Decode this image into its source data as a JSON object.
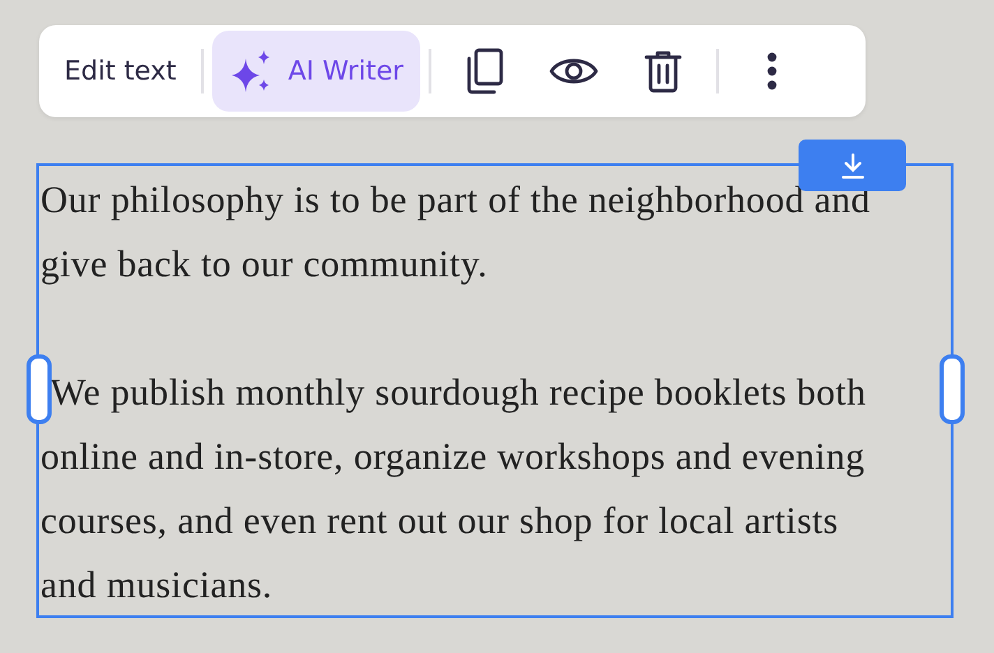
{
  "toolbar": [
    {
      "kind": "text",
      "label": "Edit text",
      "selected": false
    },
    {
      "kind": "divider"
    },
    {
      "kind": "ai",
      "label": "AI Writer",
      "selected": true
    },
    {
      "kind": "divider"
    },
    {
      "kind": "copy",
      "selected": false
    },
    {
      "kind": "view",
      "selected": false
    },
    {
      "kind": "delete",
      "selected": false
    },
    {
      "kind": "divider"
    },
    {
      "kind": "more",
      "selected": false
    }
  ],
  "text_block": {
    "paragraphs": [
      [
        "Our philosophy is to be part of the neighborhood and",
        "give back to our community."
      ],
      [
        "We publish monthly sourdough recipe booklets both",
        "online and in-store, organize workshops and evening",
        "courses, and even rent out our shop for local artists",
        "and musicians."
      ]
    ]
  }
}
